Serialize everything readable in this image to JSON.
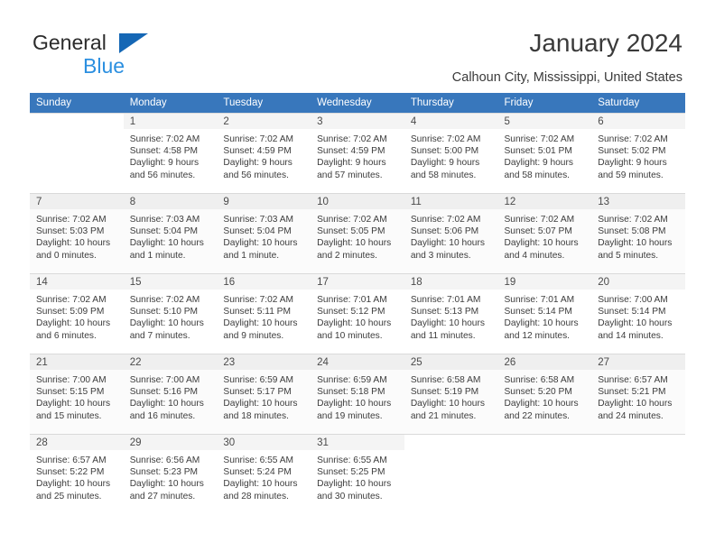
{
  "brand": {
    "name_part1": "General",
    "name_part2": "Blue",
    "triangle_icon": "triangle-icon",
    "accent_dark": "#1567b5",
    "accent_light": "#2b8fe0"
  },
  "header": {
    "title": "January 2024",
    "location": "Calhoun City, Mississippi, United States"
  },
  "calendar": {
    "header_bg": "#3877bc",
    "weekday_headers": [
      "Sunday",
      "Monday",
      "Tuesday",
      "Wednesday",
      "Thursday",
      "Friday",
      "Saturday"
    ],
    "weeks": [
      [
        {
          "day": "",
          "sunrise": "",
          "sunset": "",
          "daylight": ""
        },
        {
          "day": "1",
          "sunrise": "Sunrise: 7:02 AM",
          "sunset": "Sunset: 4:58 PM",
          "daylight": "Daylight: 9 hours and 56 minutes."
        },
        {
          "day": "2",
          "sunrise": "Sunrise: 7:02 AM",
          "sunset": "Sunset: 4:59 PM",
          "daylight": "Daylight: 9 hours and 56 minutes."
        },
        {
          "day": "3",
          "sunrise": "Sunrise: 7:02 AM",
          "sunset": "Sunset: 4:59 PM",
          "daylight": "Daylight: 9 hours and 57 minutes."
        },
        {
          "day": "4",
          "sunrise": "Sunrise: 7:02 AM",
          "sunset": "Sunset: 5:00 PM",
          "daylight": "Daylight: 9 hours and 58 minutes."
        },
        {
          "day": "5",
          "sunrise": "Sunrise: 7:02 AM",
          "sunset": "Sunset: 5:01 PM",
          "daylight": "Daylight: 9 hours and 58 minutes."
        },
        {
          "day": "6",
          "sunrise": "Sunrise: 7:02 AM",
          "sunset": "Sunset: 5:02 PM",
          "daylight": "Daylight: 9 hours and 59 minutes."
        }
      ],
      [
        {
          "day": "7",
          "sunrise": "Sunrise: 7:02 AM",
          "sunset": "Sunset: 5:03 PM",
          "daylight": "Daylight: 10 hours and 0 minutes."
        },
        {
          "day": "8",
          "sunrise": "Sunrise: 7:03 AM",
          "sunset": "Sunset: 5:04 PM",
          "daylight": "Daylight: 10 hours and 1 minute."
        },
        {
          "day": "9",
          "sunrise": "Sunrise: 7:03 AM",
          "sunset": "Sunset: 5:04 PM",
          "daylight": "Daylight: 10 hours and 1 minute."
        },
        {
          "day": "10",
          "sunrise": "Sunrise: 7:02 AM",
          "sunset": "Sunset: 5:05 PM",
          "daylight": "Daylight: 10 hours and 2 minutes."
        },
        {
          "day": "11",
          "sunrise": "Sunrise: 7:02 AM",
          "sunset": "Sunset: 5:06 PM",
          "daylight": "Daylight: 10 hours and 3 minutes."
        },
        {
          "day": "12",
          "sunrise": "Sunrise: 7:02 AM",
          "sunset": "Sunset: 5:07 PM",
          "daylight": "Daylight: 10 hours and 4 minutes."
        },
        {
          "day": "13",
          "sunrise": "Sunrise: 7:02 AM",
          "sunset": "Sunset: 5:08 PM",
          "daylight": "Daylight: 10 hours and 5 minutes."
        }
      ],
      [
        {
          "day": "14",
          "sunrise": "Sunrise: 7:02 AM",
          "sunset": "Sunset: 5:09 PM",
          "daylight": "Daylight: 10 hours and 6 minutes."
        },
        {
          "day": "15",
          "sunrise": "Sunrise: 7:02 AM",
          "sunset": "Sunset: 5:10 PM",
          "daylight": "Daylight: 10 hours and 7 minutes."
        },
        {
          "day": "16",
          "sunrise": "Sunrise: 7:02 AM",
          "sunset": "Sunset: 5:11 PM",
          "daylight": "Daylight: 10 hours and 9 minutes."
        },
        {
          "day": "17",
          "sunrise": "Sunrise: 7:01 AM",
          "sunset": "Sunset: 5:12 PM",
          "daylight": "Daylight: 10 hours and 10 minutes."
        },
        {
          "day": "18",
          "sunrise": "Sunrise: 7:01 AM",
          "sunset": "Sunset: 5:13 PM",
          "daylight": "Daylight: 10 hours and 11 minutes."
        },
        {
          "day": "19",
          "sunrise": "Sunrise: 7:01 AM",
          "sunset": "Sunset: 5:14 PM",
          "daylight": "Daylight: 10 hours and 12 minutes."
        },
        {
          "day": "20",
          "sunrise": "Sunrise: 7:00 AM",
          "sunset": "Sunset: 5:14 PM",
          "daylight": "Daylight: 10 hours and 14 minutes."
        }
      ],
      [
        {
          "day": "21",
          "sunrise": "Sunrise: 7:00 AM",
          "sunset": "Sunset: 5:15 PM",
          "daylight": "Daylight: 10 hours and 15 minutes."
        },
        {
          "day": "22",
          "sunrise": "Sunrise: 7:00 AM",
          "sunset": "Sunset: 5:16 PM",
          "daylight": "Daylight: 10 hours and 16 minutes."
        },
        {
          "day": "23",
          "sunrise": "Sunrise: 6:59 AM",
          "sunset": "Sunset: 5:17 PM",
          "daylight": "Daylight: 10 hours and 18 minutes."
        },
        {
          "day": "24",
          "sunrise": "Sunrise: 6:59 AM",
          "sunset": "Sunset: 5:18 PM",
          "daylight": "Daylight: 10 hours and 19 minutes."
        },
        {
          "day": "25",
          "sunrise": "Sunrise: 6:58 AM",
          "sunset": "Sunset: 5:19 PM",
          "daylight": "Daylight: 10 hours and 21 minutes."
        },
        {
          "day": "26",
          "sunrise": "Sunrise: 6:58 AM",
          "sunset": "Sunset: 5:20 PM",
          "daylight": "Daylight: 10 hours and 22 minutes."
        },
        {
          "day": "27",
          "sunrise": "Sunrise: 6:57 AM",
          "sunset": "Sunset: 5:21 PM",
          "daylight": "Daylight: 10 hours and 24 minutes."
        }
      ],
      [
        {
          "day": "28",
          "sunrise": "Sunrise: 6:57 AM",
          "sunset": "Sunset: 5:22 PM",
          "daylight": "Daylight: 10 hours and 25 minutes."
        },
        {
          "day": "29",
          "sunrise": "Sunrise: 6:56 AM",
          "sunset": "Sunset: 5:23 PM",
          "daylight": "Daylight: 10 hours and 27 minutes."
        },
        {
          "day": "30",
          "sunrise": "Sunrise: 6:55 AM",
          "sunset": "Sunset: 5:24 PM",
          "daylight": "Daylight: 10 hours and 28 minutes."
        },
        {
          "day": "31",
          "sunrise": "Sunrise: 6:55 AM",
          "sunset": "Sunset: 5:25 PM",
          "daylight": "Daylight: 10 hours and 30 minutes."
        },
        {
          "day": "",
          "sunrise": "",
          "sunset": "",
          "daylight": ""
        },
        {
          "day": "",
          "sunrise": "",
          "sunset": "",
          "daylight": ""
        },
        {
          "day": "",
          "sunrise": "",
          "sunset": "",
          "daylight": ""
        }
      ]
    ]
  }
}
